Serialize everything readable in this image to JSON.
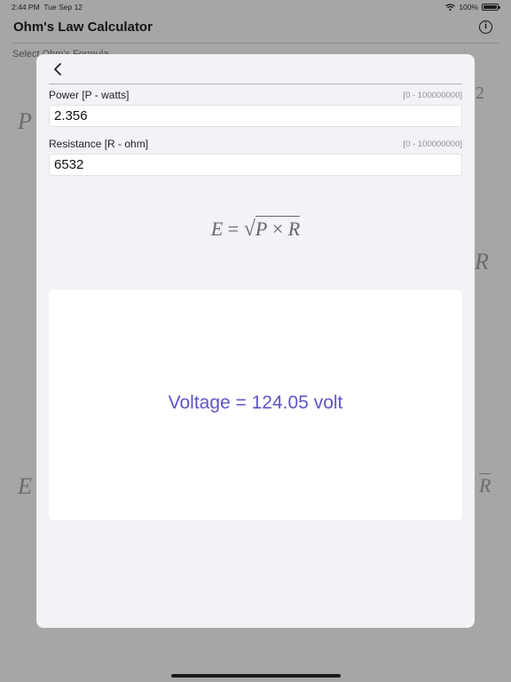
{
  "status_bar": {
    "time": "2:44 PM",
    "date": "Tue Sep 12",
    "battery": "100%"
  },
  "background": {
    "title": "Ohm's Law Calculator",
    "info_icon_glyph": "i",
    "select_label": "Select Ohm's Formula",
    "formula_fragments": {
      "left_top": "P",
      "left_bottom": "E",
      "right_top": "2",
      "right_mid": "R",
      "right_bottom": "R"
    }
  },
  "modal": {
    "back_icon": "chevron-left-icon",
    "fields": [
      {
        "label": "Power [P - watts]",
        "range": "[0 - 100000000]",
        "value": "2.356"
      },
      {
        "label": "Resistance [R - ohm]",
        "range": "[0 - 100000000]",
        "value": "6532"
      }
    ],
    "formula": {
      "lhs": "E",
      "equals": "=",
      "p": "P",
      "times": "×",
      "r": "R"
    },
    "result": "Voltage = 124.05 volt"
  },
  "colors": {
    "accent": "#5b55c6",
    "overlay": "#a6a6a6",
    "sheet": "#f2f2f7"
  }
}
